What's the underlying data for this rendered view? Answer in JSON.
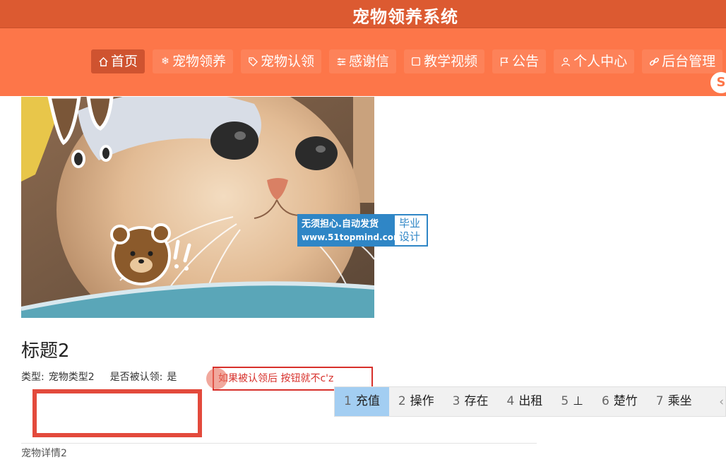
{
  "header": {
    "site_title": "宠物领养系统"
  },
  "nav": {
    "items": [
      {
        "label": "首页",
        "icon": "home-icon",
        "active": true
      },
      {
        "label": "宠物领养",
        "icon": "snowflake-icon"
      },
      {
        "label": "宠物认领",
        "icon": "tag-icon"
      },
      {
        "label": "感谢信",
        "icon": "sliders-icon"
      },
      {
        "label": "教学视频",
        "icon": "square-icon"
      },
      {
        "label": "公告",
        "icon": "flag-icon"
      },
      {
        "label": "个人中心",
        "icon": "user-icon"
      },
      {
        "label": "后台管理",
        "icon": "link-icon"
      }
    ],
    "corner_badge": "S"
  },
  "pet": {
    "title": "标题2",
    "type_label": "类型:",
    "type_value": "宠物类型2",
    "claimed_label": "是否被认领:",
    "claimed_value": "是",
    "detail": "宠物详情2"
  },
  "watermark": {
    "line1": "无须担心.自动发货",
    "line2": "www.51topmind.com",
    "side1": "毕业",
    "side2": "设计"
  },
  "annotation": {
    "note": "如果被认领后 按钮就不c'z"
  },
  "ime_candidates": [
    {
      "num": "1",
      "text": "充值",
      "selected": true
    },
    {
      "num": "2",
      "text": "操作"
    },
    {
      "num": "3",
      "text": "存在"
    },
    {
      "num": "4",
      "text": "出租"
    },
    {
      "num": "5",
      "text": "⊥"
    },
    {
      "num": "6",
      "text": "楚竹"
    },
    {
      "num": "7",
      "text": "乘坐"
    }
  ],
  "colors": {
    "header": "#dc5a31",
    "navbar": "#fd7649",
    "active_tab": "#cf5330",
    "annotation": "#d7302b"
  }
}
